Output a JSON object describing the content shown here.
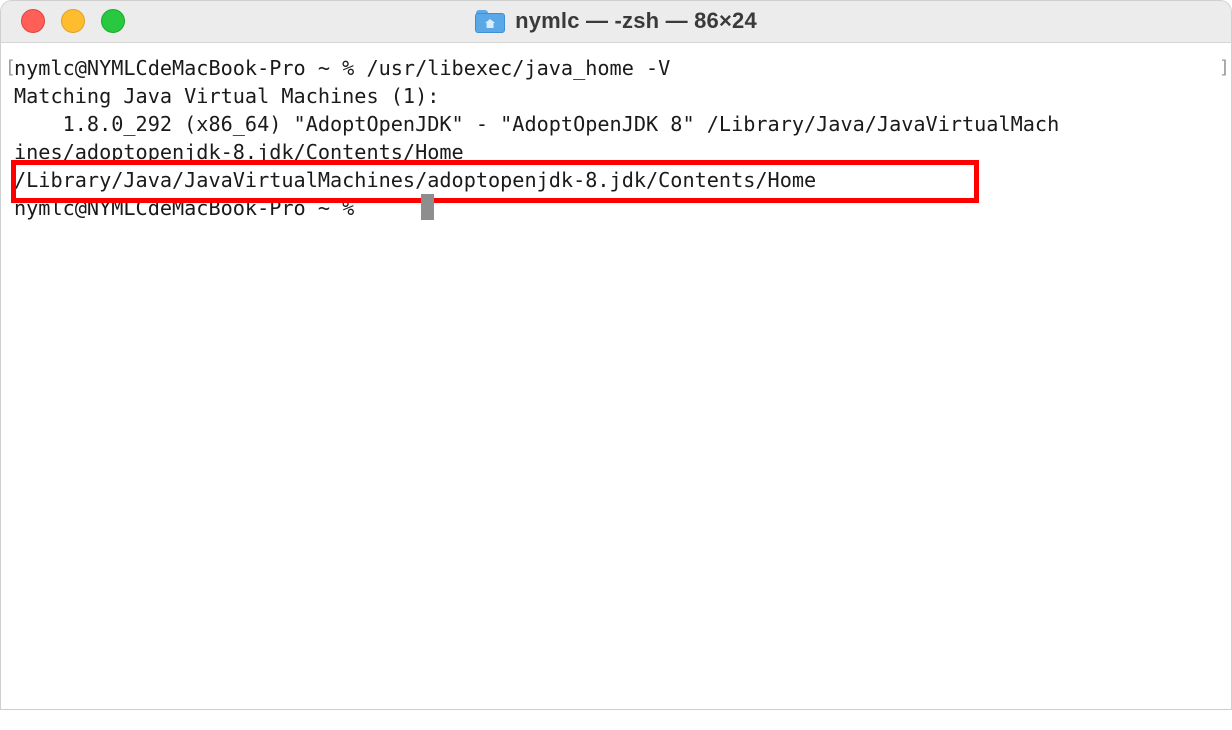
{
  "window": {
    "title": "nymlc — -zsh — 86×24",
    "folder_icon": "home-folder-icon"
  },
  "terminal": {
    "lines": [
      "nymlc@NYMLCdeMacBook-Pro ~ % /usr/libexec/java_home -V",
      "Matching Java Virtual Machines (1):",
      "    1.8.0_292 (x86_64) \"AdoptOpenJDK\" - \"AdoptOpenJDK 8\" /Library/Java/JavaVirtualMach",
      "ines/adoptopenjdk-8.jdk/Contents/Home",
      "/Library/Java/JavaVirtualMachines/adoptopenjdk-8.jdk/Contents/Home",
      "nymlc@NYMLCdeMacBook-Pro ~ % "
    ],
    "left_bracket": "[",
    "right_bracket": "]"
  },
  "colors": {
    "highlight": "#ff0000",
    "close": "#ff5f57",
    "minimize": "#febc2e",
    "maximize": "#28c840"
  }
}
